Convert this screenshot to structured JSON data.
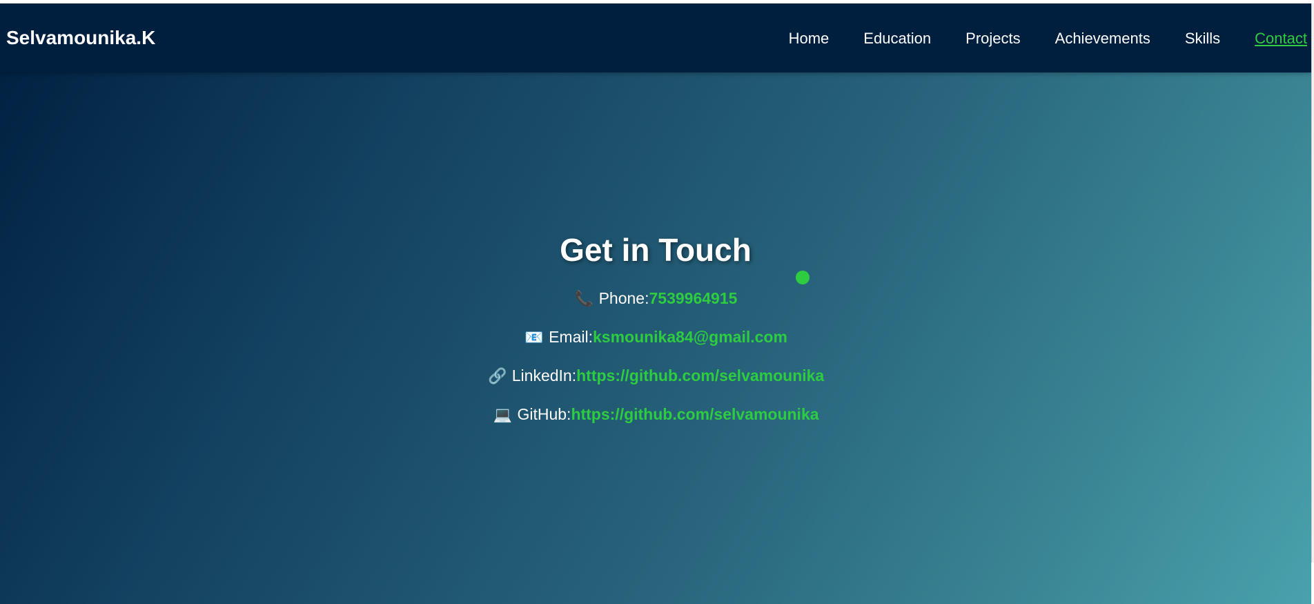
{
  "header": {
    "brand": "Selvamounika.K",
    "nav": [
      {
        "label": "Home",
        "active": false
      },
      {
        "label": "Education",
        "active": false
      },
      {
        "label": "Projects",
        "active": false
      },
      {
        "label": "Achievements",
        "active": false
      },
      {
        "label": "Skills",
        "active": false
      },
      {
        "label": "Contact",
        "active": true
      }
    ]
  },
  "contact": {
    "title": "Get in Touch",
    "items": [
      {
        "icon": "phone-icon",
        "glyph": "📞",
        "label": "Phone:",
        "value": "7539964915"
      },
      {
        "icon": "email-icon",
        "glyph": "📧",
        "label": "Email:",
        "value": "ksmounika84@gmail.com"
      },
      {
        "icon": "link-icon",
        "glyph": "🔗",
        "label": "LinkedIn:",
        "value": "https://github.com/selvamounika"
      },
      {
        "icon": "laptop-icon",
        "glyph": "💻",
        "label": "GitHub:",
        "value": "https://github.com/selvamounika"
      }
    ]
  },
  "colors": {
    "navbar": "#001f3f",
    "accent": "#2ecc40",
    "text": "#ffffff"
  }
}
